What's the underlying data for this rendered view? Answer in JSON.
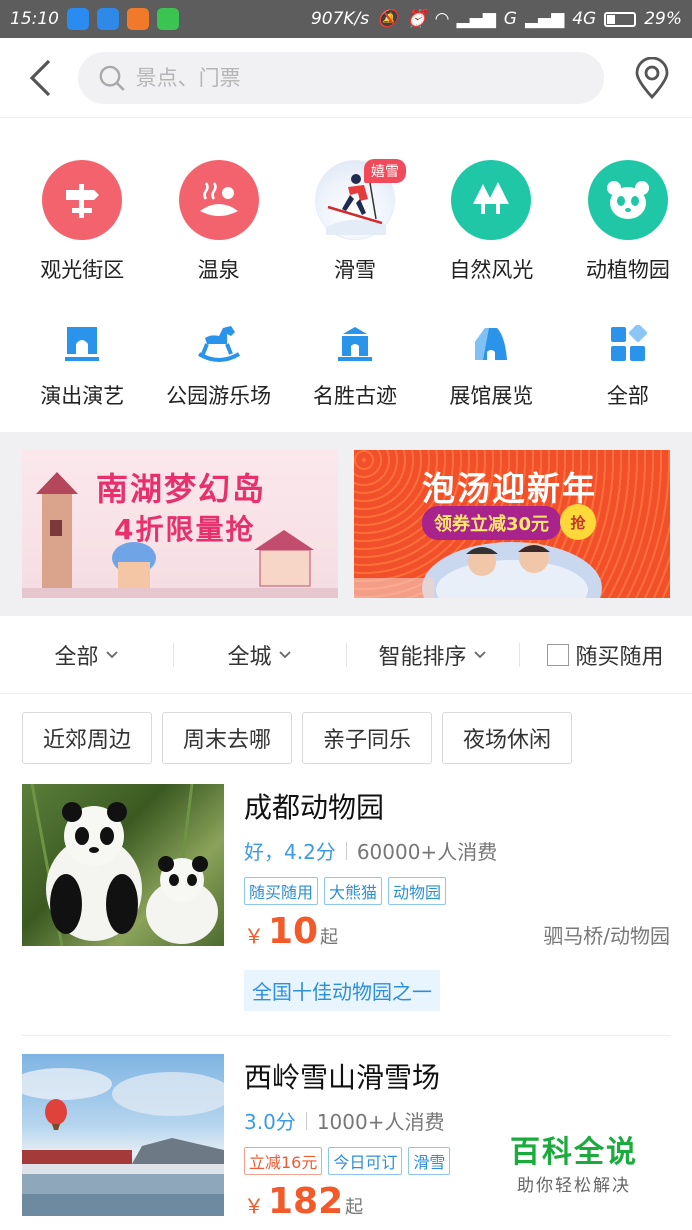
{
  "status_bar": {
    "time": "15:10",
    "net_speed": "907K/s",
    "signal_text": "G",
    "network": "4G",
    "battery": "29%",
    "battery_level": 0.29
  },
  "header": {
    "search_placeholder": "景点、门票"
  },
  "categories_row1": [
    {
      "label": "观光街区",
      "icon": "signpost-icon",
      "color": "#f3636d"
    },
    {
      "label": "温泉",
      "icon": "hot-spring-icon",
      "color": "#f3636d"
    },
    {
      "label": "滑雪",
      "icon": "skier-icon",
      "badge": "嬉雪"
    },
    {
      "label": "自然风光",
      "icon": "trees-icon",
      "color": "#1fc7a6"
    },
    {
      "label": "动植物园",
      "icon": "panda-icon",
      "color": "#1fc7a6"
    }
  ],
  "categories_row2": [
    {
      "label": "演出演艺",
      "icon": "stage-icon"
    },
    {
      "label": "公园游乐场",
      "icon": "rocking-horse-icon"
    },
    {
      "label": "名胜古迹",
      "icon": "temple-icon"
    },
    {
      "label": "展馆展览",
      "icon": "museum-icon"
    },
    {
      "label": "全部",
      "icon": "grid-icon"
    }
  ],
  "banners": [
    {
      "line1": "南湖梦幻岛",
      "line2": "4折限量抢"
    },
    {
      "line1": "泡汤迎新年",
      "pill": "领券立减30元",
      "grab": "抢"
    }
  ],
  "filters": {
    "all": "全部",
    "city": "全城",
    "sort": "智能排序",
    "flexible": "随买随用"
  },
  "tags": [
    "近郊周边",
    "周末去哪",
    "亲子同乐",
    "夜场休闲"
  ],
  "listings": [
    {
      "title": "成都动物园",
      "rating": "好，4.2分",
      "sales": "60000+人消费",
      "tags": [
        "随买随用",
        "大熊猫",
        "动物园"
      ],
      "currency": "￥",
      "price": "10",
      "price_suffix": "起",
      "area": "驷马桥/动物园",
      "highlight": "全国十佳动物园之一"
    },
    {
      "title": "西岭雪山滑雪场",
      "rating": "3.0分",
      "sales": "1000+人消费",
      "tags": [
        "立减16元",
        "今日可订",
        "滑雪"
      ],
      "currency": "￥",
      "price": "182",
      "price_suffix": "起"
    }
  ],
  "watermark": {
    "title": "百科全说",
    "subtitle": "助你轻松解决"
  }
}
